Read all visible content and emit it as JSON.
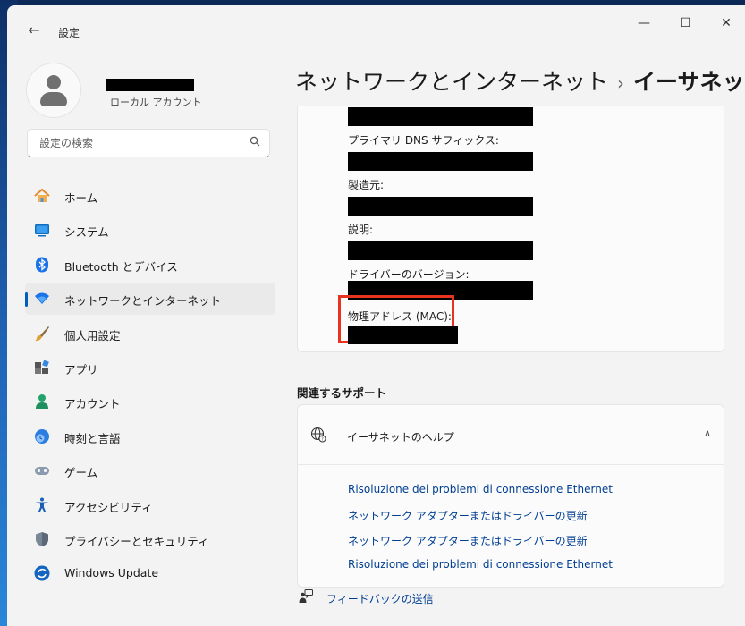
{
  "window": {
    "back_glyph": "←",
    "title": "設定",
    "controls": {
      "minimize": "—",
      "maximize": "☐",
      "close": "✕"
    }
  },
  "profile": {
    "account_type": "ローカル アカウント"
  },
  "search": {
    "placeholder": "設定の検索",
    "icon": "search-icon"
  },
  "sidebar": {
    "items": [
      {
        "label": "ホーム",
        "icon": "home-icon"
      },
      {
        "label": "システム",
        "icon": "system-icon"
      },
      {
        "label": "Bluetooth とデバイス",
        "icon": "bluetooth-icon"
      },
      {
        "label": "ネットワークとインターネット",
        "icon": "wifi-icon",
        "active": true
      },
      {
        "label": "個人用設定",
        "icon": "brush-icon"
      },
      {
        "label": "アプリ",
        "icon": "apps-icon"
      },
      {
        "label": "アカウント",
        "icon": "person-icon"
      },
      {
        "label": "時刻と言語",
        "icon": "globe-clock-icon"
      },
      {
        "label": "ゲーム",
        "icon": "gamepad-icon"
      },
      {
        "label": "アクセシビリティ",
        "icon": "accessibility-icon"
      },
      {
        "label": "プライバシーとセキュリティ",
        "icon": "shield-icon"
      },
      {
        "label": "Windows Update",
        "icon": "update-icon"
      }
    ]
  },
  "header": {
    "crumb": "ネットワークとインターネット",
    "separator": "›",
    "current": "イーサネット"
  },
  "properties": {
    "labels": {
      "dns_suffix": "プライマリ DNS サフィックス:",
      "manufacturer": "製造元:",
      "description": "説明:",
      "driver_version": "ドライバーのバージョン:",
      "mac": "物理アドレス (MAC):"
    }
  },
  "related": {
    "title": "関連するサポート",
    "help_title": "イーサネットのヘルプ",
    "chevron": "∧",
    "links": [
      "Risoluzione dei problemi di connessione Ethernet",
      "ネットワーク アダプターまたはドライバーの更新",
      "ネットワーク アダプターまたはドライバーの更新",
      "Risoluzione dei problemi di connessione Ethernet"
    ]
  },
  "feedback": {
    "label": "フィードバックの送信"
  },
  "colors": {
    "accent": "#005fb8",
    "link": "#003e92",
    "highlight": "#e8331f"
  }
}
